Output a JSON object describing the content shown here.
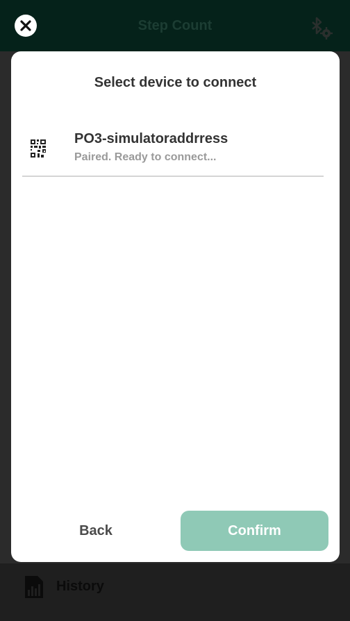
{
  "app": {
    "title": "Step Count"
  },
  "bottom_nav": {
    "history_label": "History"
  },
  "modal": {
    "title": "Select device to connect",
    "devices": [
      {
        "name": "PO3-simulatoraddrress",
        "status": "Paired. Ready to connect..."
      }
    ],
    "back_label": "Back",
    "confirm_label": "Confirm"
  },
  "colors": {
    "header_bg": "#05221a",
    "confirm_button": "#8fc9b6",
    "overlay": "#2b2b2b"
  },
  "icons": {
    "close": "close-icon",
    "bluetooth_settings": "bluetooth-settings-icon",
    "history": "bar-chart-icon",
    "device": "qr-code-icon"
  }
}
